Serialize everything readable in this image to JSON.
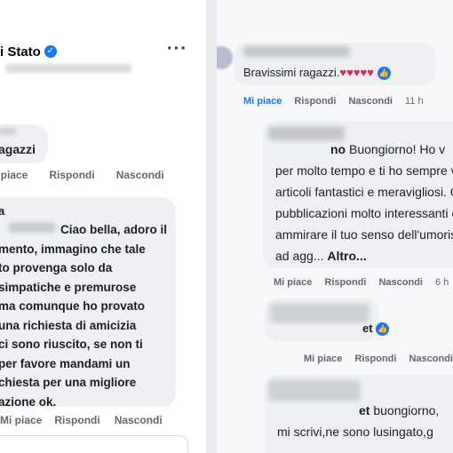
{
  "left": {
    "page_name": "i Stato",
    "menu_icon": "ellipsis-icon",
    "comment1": {
      "text": "agazzi"
    },
    "actions": {
      "like": "i piace",
      "reply": "Rispondi",
      "hide": "Nascondi"
    },
    "comment2": {
      "name_fragment": "a",
      "lines": [
        "Ciao bella, adoro il",
        "mento, immagino che tale",
        "to provenga solo da",
        "simpatiche e premurose",
        "ma comunque ho provato",
        "una richiesta di amicizia",
        "ci sono riuscito, se non ti",
        "per favore mandami un",
        "chiesta per una migliore",
        "azione ok."
      ]
    },
    "actions2": {
      "like": "Mi piace",
      "reply": "Rispondi",
      "hide": "Nascondi"
    }
  },
  "right": {
    "comment1": {
      "text": "Bravissimi ragazzi.",
      "hearts": "♥♥♥♥♥"
    },
    "actions1": {
      "like": "Mi piace",
      "reply": "Rispondi",
      "hide": "Nascondi",
      "time": "11 h"
    },
    "comment2": {
      "name_tail": "no",
      "first_line_rest": " Buongiorno! Ho v",
      "lines": [
        "per molto tempo e ti ho sempre v",
        "articoli fantastici e meravigliosi. Q",
        "pubblicazioni molto interessanti e",
        "ammirare il tuo senso dell'umoris"
      ],
      "last_line": "ad agg... ",
      "more": "Altro..."
    },
    "actions2": {
      "like": "Mi piace",
      "reply": "Rispondi",
      "hide": "Nascondi",
      "time": "6 h"
    },
    "comment3": {
      "name_tail": "et"
    },
    "actions3": {
      "like": "Mi piace",
      "reply": "Rispondi",
      "hide": "Nascondi"
    },
    "comment4": {
      "name_tail": "et",
      "first_line_rest": " buongiorno,",
      "line2": "mi scrivi,ne sono lusingato,g"
    }
  }
}
